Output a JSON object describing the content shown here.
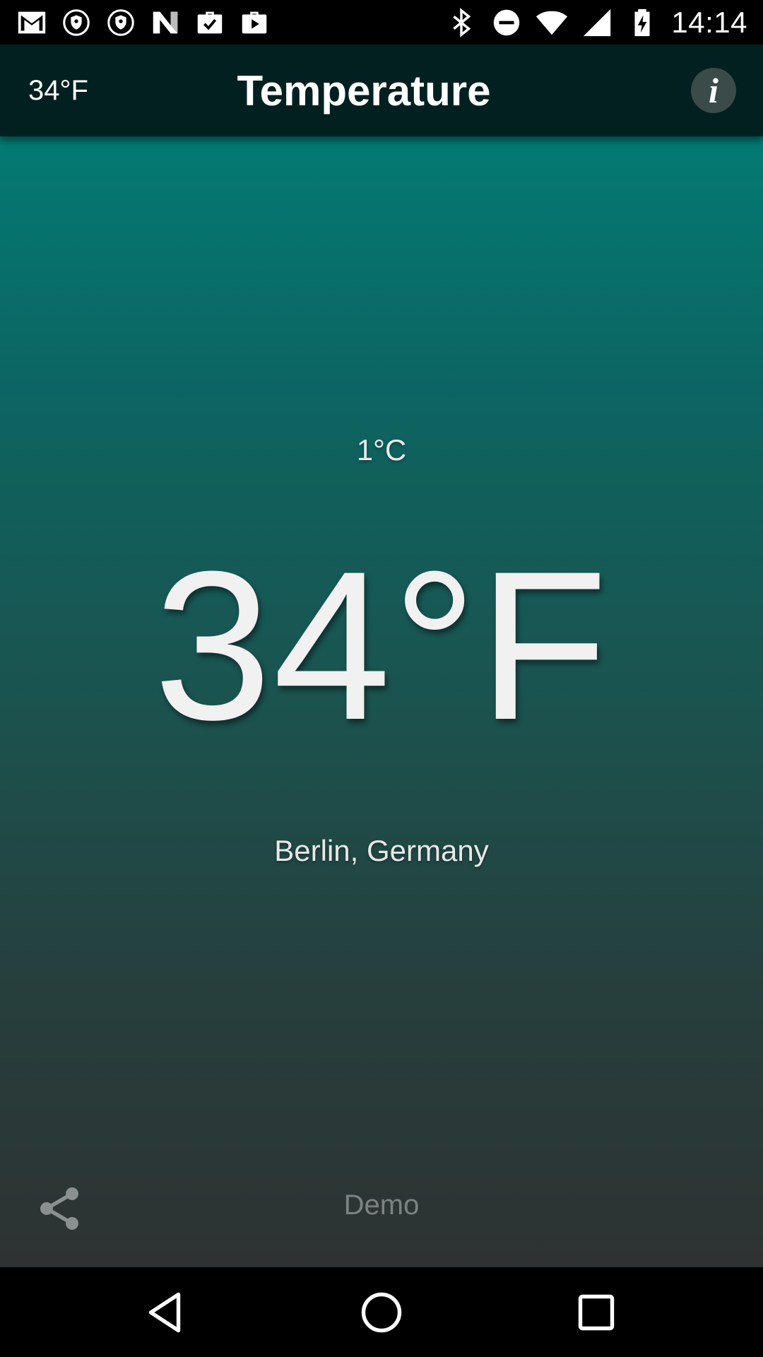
{
  "status_bar": {
    "time": "14:14",
    "left_icons": [
      "gmail-icon",
      "shield-icon",
      "shield-icon",
      "n-app-icon",
      "briefcase-check-icon",
      "briefcase-play-icon"
    ],
    "right_icons": [
      "bluetooth-icon",
      "do-not-disturb-icon",
      "wifi-icon",
      "cell-signal-icon",
      "battery-charging-icon"
    ]
  },
  "app_bar": {
    "temperature": "34°F",
    "title": "Temperature",
    "info_label": "i"
  },
  "main": {
    "celsius": "1°C",
    "fahrenheit": "34°F",
    "location": "Berlin, Germany",
    "demo_label": "Demo"
  },
  "nav_bar": {
    "buttons": [
      "back-icon",
      "home-icon",
      "recents-icon"
    ]
  },
  "colors": {
    "app_bar_bg": "#02201f",
    "gradient_top": "#037a73",
    "gradient_bottom": "#2e3232",
    "text_primary": "#f1f1f1",
    "demo_text": "#7c8282"
  }
}
